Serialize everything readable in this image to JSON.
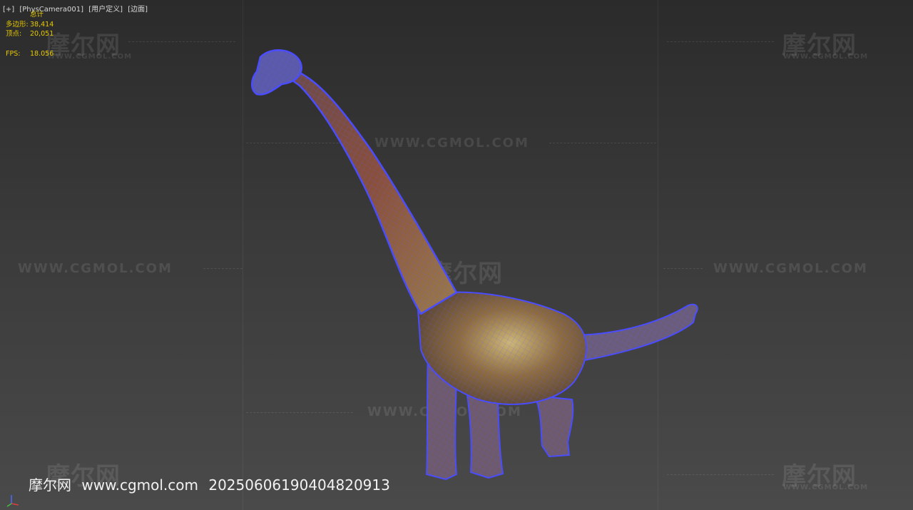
{
  "viewport": {
    "labels": [
      "[+]",
      "[PhysCamera001]",
      "[用户定义]",
      "[边面]"
    ]
  },
  "stats": {
    "header": "总计",
    "polygons_label": "多边形:",
    "polygons_value": "38,414",
    "vertices_label": "顶点:",
    "vertices_value": "20,051",
    "fps_label": "FPS:",
    "fps_value": "18.056"
  },
  "watermark": {
    "brand_cn": "摩尔网",
    "url": "WWW.CGMOL.COM"
  },
  "footer": {
    "brand": "摩尔网",
    "site": "www.cgmol.com",
    "id": "20250606190404820913"
  },
  "colors": {
    "background": "#3a3a3a",
    "stats_text": "#e6c800",
    "wireframe": "#4a4cff",
    "model_body": "#7a5a3a"
  }
}
